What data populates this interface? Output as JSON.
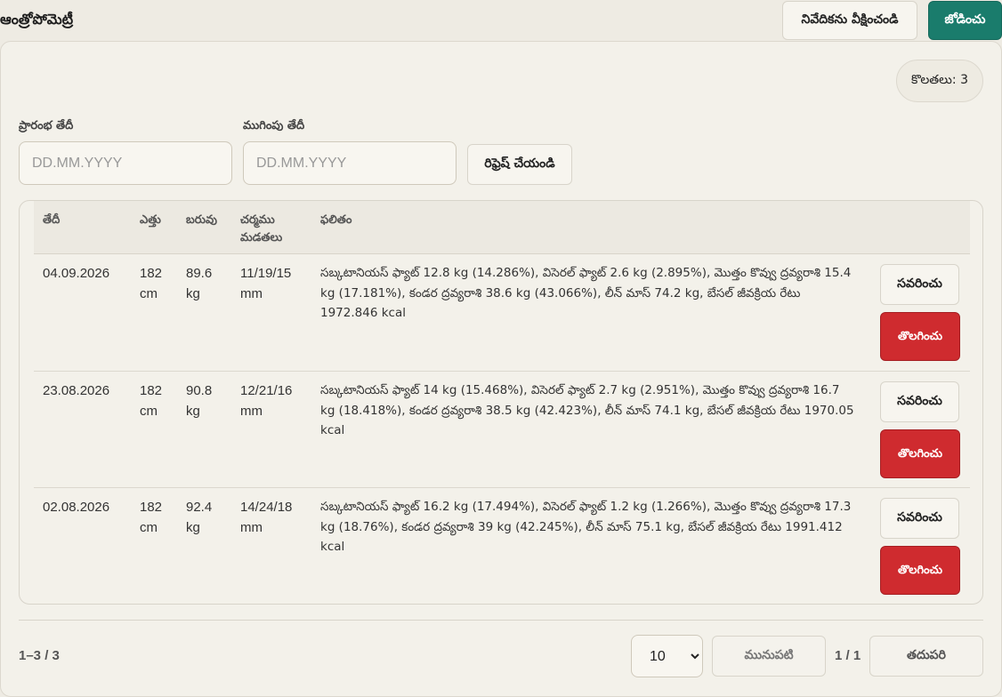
{
  "header": {
    "title": "ఆంత్రోపోమెట్రీ",
    "view_report_label": "నివేదికను వీక్షించండి",
    "add_label": "జోడించు"
  },
  "records_count": "కొలతలు: 3",
  "filters": {
    "start_label": "ప్రారంభ తేదీ",
    "start_placeholder": "DD.MM.YYYY",
    "end_label": "ముగింపు తేదీ",
    "end_placeholder": "DD.MM.YYYY",
    "refresh_label": "రిఫ్రెష్ చేయండి"
  },
  "table": {
    "columns": {
      "date": "తేదీ",
      "height": "ఎత్తు",
      "weight": "బరువు",
      "skinfold": "చర్మము మడతలు",
      "result": "ఫలితం"
    },
    "rows": [
      {
        "date": "04.09.2026",
        "height": "182 cm",
        "weight": "89.6 kg",
        "skinfold": "11/19/15 mm",
        "result": "సబ్కటానియస్ ఫ్యాట్ 12.8 kg (14.286%), విసెరల్ ఫ్యాట్ 2.6 kg (2.895%), మొత్తం కొవ్వు ద్రవ్యరాశి 15.4 kg (17.181%), కండర ద్రవ్యరాశి 38.6 kg (43.066%), లీన్ మాస్ 74.2 kg, బేసల్ జీవక్రియ రేటు 1972.846 kcal",
        "edit_label": "సవరించు",
        "delete_label": "తొలగించు"
      },
      {
        "date": "23.08.2026",
        "height": "182 cm",
        "weight": "90.8 kg",
        "skinfold": "12/21/16 mm",
        "result": "సబ్కటానియస్ ఫ్యాట్ 14 kg (15.468%), విసెరల్ ఫ్యాట్ 2.7 kg (2.951%), మొత్తం కొవ్వు ద్రవ్యరాశి 16.7 kg (18.418%), కండర ద్రవ్యరాశి 38.5 kg (42.423%), లీన్ మాస్ 74.1 kg, బేసల్ జీవక్రియ రేటు 1970.05 kcal",
        "edit_label": "సవరించు",
        "delete_label": "తొలగించు"
      },
      {
        "date": "02.08.2026",
        "height": "182 cm",
        "weight": "92.4 kg",
        "skinfold": "14/24/18 mm",
        "result": "సబ్కటానియస్ ఫ్యాట్ 16.2 kg (17.494%), విసెరల్ ఫ్యాట్ 1.2 kg (1.266%), మొత్తం కొవ్వు ద్రవ్యరాశి 17.3 kg (18.76%), కండర ద్రవ్యరాశి 39 kg (42.245%), లీన్ మాస్ 75.1 kg, బేసల్ జీవక్రియ రేటు 1991.412 kcal",
        "edit_label": "సవరించు",
        "delete_label": "తొలగించు"
      }
    ]
  },
  "pagination": {
    "range": "1–3 / 3",
    "page_size": "10",
    "page_size_options": [
      "10"
    ],
    "prev_label": "మునుపటి",
    "page_indicator": "1 / 1",
    "next_label": "తదుపరి"
  }
}
